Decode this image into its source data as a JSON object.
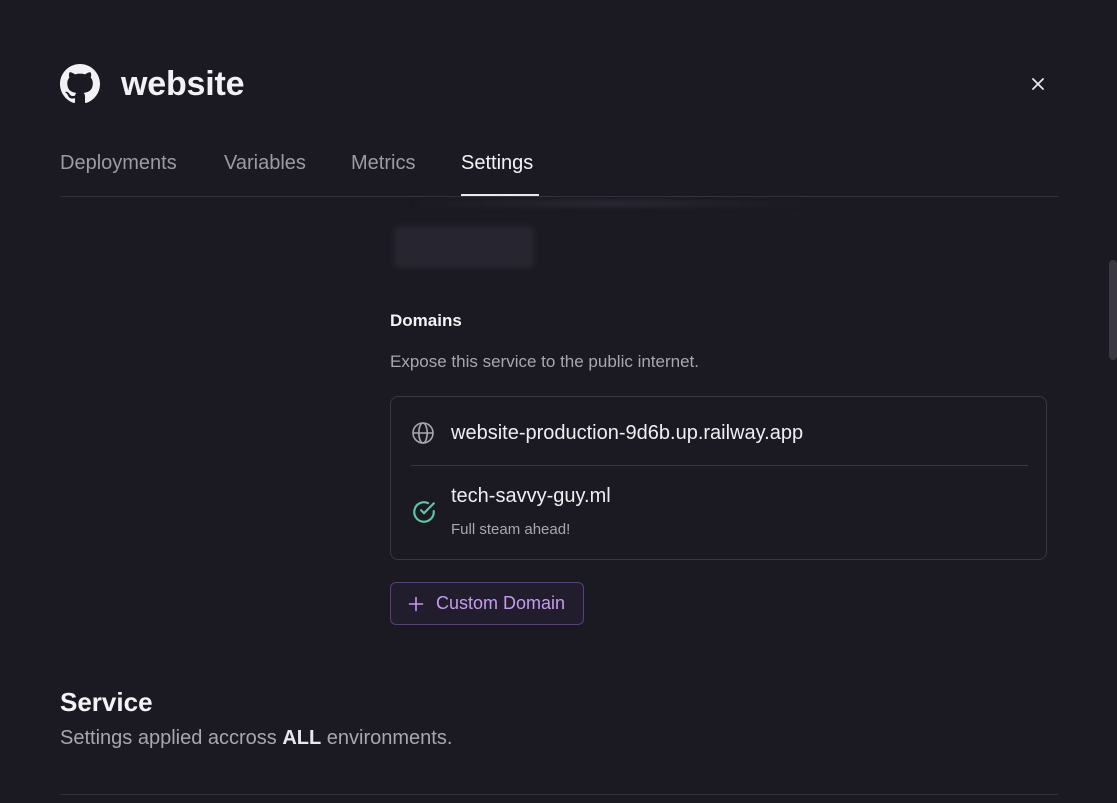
{
  "header": {
    "icon": "github-icon",
    "title": "website",
    "close_icon": "close-icon"
  },
  "tabs": [
    {
      "label": "Deployments",
      "active": false
    },
    {
      "label": "Variables",
      "active": false
    },
    {
      "label": "Metrics",
      "active": false
    },
    {
      "label": "Settings",
      "active": true
    }
  ],
  "domains": {
    "heading": "Domains",
    "description": "Expose this service to the public internet.",
    "items": [
      {
        "icon": "globe-icon",
        "domain": "website-production-9d6b.up.railway.app"
      },
      {
        "icon": "check-circle-icon",
        "domain": "tech-savvy-guy.ml",
        "status": "Full steam ahead!",
        "status_color": "#5fc4a3"
      }
    ],
    "add_button": {
      "icon": "plus-icon",
      "label": "Custom Domain",
      "color": "#c59bf0"
    }
  },
  "service": {
    "title": "Service",
    "desc_prefix": "Settings applied accross ",
    "desc_emphasis": "ALL",
    "desc_suffix": " environments."
  },
  "colors": {
    "background": "#1b1922",
    "accent": "#c59bf0",
    "success": "#5fc4a3"
  }
}
